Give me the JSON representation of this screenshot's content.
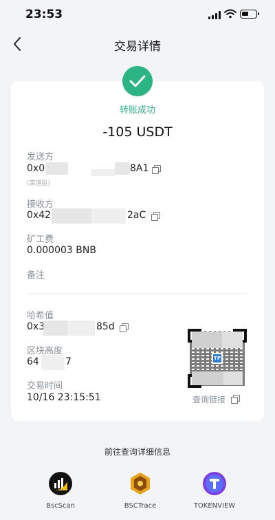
{
  "status_bar": {
    "time": "23:53"
  },
  "header": {
    "title": "交易详情"
  },
  "transaction": {
    "status": "转账成功",
    "amount": "-105 USDT",
    "sender": {
      "label": "发送方",
      "address_start": "0x0",
      "address_end": "8A1",
      "note": "(栾道臣)"
    },
    "receiver": {
      "label": "接收方",
      "address_start": "0x42",
      "address_end": "2aC"
    },
    "fee": {
      "label": "矿工费",
      "value": "0.000003 BNB"
    },
    "memo": {
      "label": "备注",
      "value": ""
    },
    "hash": {
      "label": "哈希值",
      "value_start": "0x3",
      "value_end": "85d"
    },
    "block_height": {
      "label": "区块高度",
      "value_start": "64",
      "value_end": "7"
    },
    "time": {
      "label": "交易时间",
      "value": "10/16 23:15:51"
    },
    "qr_logo_text": "TP",
    "query_link": "查询链接"
  },
  "footer": {
    "goto_text": "前往查询详细信息",
    "explorers": [
      {
        "name": "BscScan",
        "icon": "bscscan-icon",
        "color": "#111111"
      },
      {
        "name": "BSCTrace",
        "icon": "bsctrace-icon",
        "color": "#e8a317"
      },
      {
        "name": "TOKENVIEW",
        "icon": "tokenview-icon",
        "color": "#7b3fe4"
      }
    ]
  },
  "colors": {
    "success": "#2bb585",
    "background": "#f3f4f6"
  }
}
